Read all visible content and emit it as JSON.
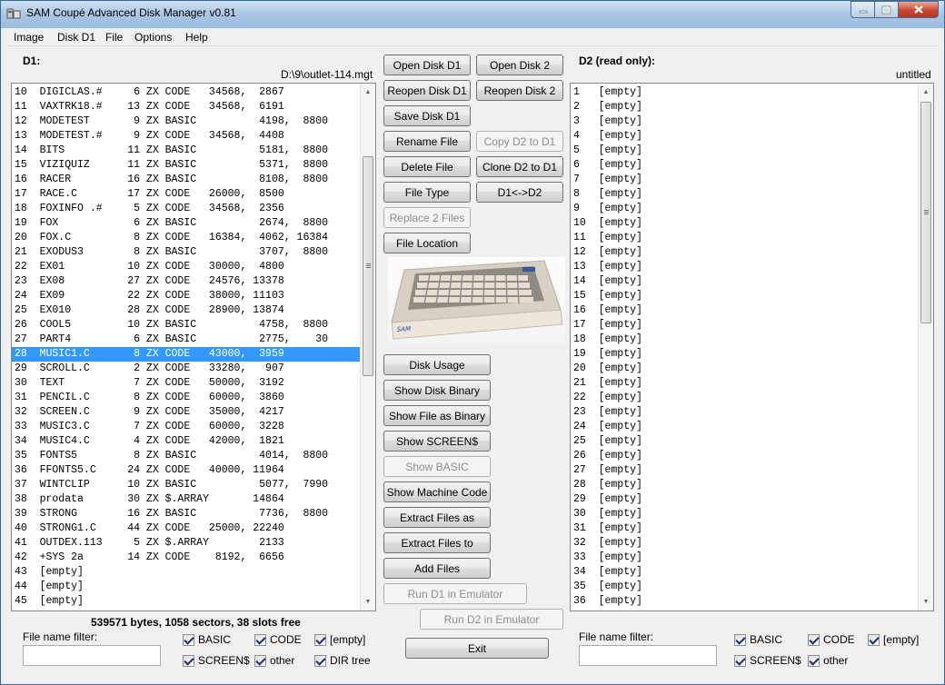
{
  "window": {
    "title": "SAM Coupé Advanced Disk Manager v0.81"
  },
  "menu": [
    "Image",
    "Disk D1",
    "File",
    "Options",
    "Help"
  ],
  "d1": {
    "label": "D1:",
    "path": "D:\\9\\outlet-114.mgt",
    "status": "539571 bytes, 1058 sectors, 38 slots free",
    "selected_index": 18,
    "rows": [
      "10  DIGICLAS.#     6 ZX CODE   34568,  2867",
      "11  VAXTRK18.#    13 ZX CODE   34568,  6191",
      "12  MODETEST       9 ZX BASIC          4198,  8800",
      "13  MODETEST.#     9 ZX CODE   34568,  4408",
      "14  BITS          11 ZX BASIC          5181,  8800",
      "15  VIZIQUIZ      11 ZX BASIC          5371,  8800",
      "16  RACER         16 ZX BASIC          8108,  8800",
      "17  RACE.C        17 ZX CODE   26000,  8500",
      "18  FOXINFO .#     5 ZX CODE   34568,  2356",
      "19  FOX            6 ZX BASIC          2674,  8800",
      "20  FOX.C          8 ZX CODE   16384,  4062, 16384",
      "21  EXODUS3        8 ZX BASIC          3707,  8800",
      "22  EX01          10 ZX CODE   30000,  4800",
      "23  EX08          27 ZX CODE   24576, 13378",
      "24  EX09          22 ZX CODE   38000, 11103",
      "25  EX010         28 ZX CODE   28900, 13874",
      "26  COOL5         10 ZX BASIC          4758,  8800",
      "27  PART4          6 ZX BASIC          2775,    30",
      "28  MUSIC1.C       8 ZX CODE   43000,  3959",
      "29  SCROLL.C       2 ZX CODE   33280,   907",
      "30  TEXT           7 ZX CODE   50000,  3192",
      "31  PENCIL.C       8 ZX CODE   60000,  3860",
      "32  SCREEN.C       9 ZX CODE   35000,  4217",
      "33  MUSIC3.C       7 ZX CODE   60000,  3228",
      "34  MUSIC4.C       4 ZX CODE   42000,  1821",
      "35  FONTS5         8 ZX BASIC          4014,  8800",
      "36  FFONTS5.C     24 ZX CODE   40000, 11964",
      "37  WINTCLIP      10 ZX BASIC          5077,  7990",
      "38  prodata       30 ZX $.ARRAY       14864",
      "39  STRONG        16 ZX BASIC          7736,  8800",
      "40  STRONG1.C     44 ZX CODE   25000, 22240",
      "41  OUTDEX.113     5 ZX $.ARRAY        2133",
      "42  +SYS 2a       14 ZX CODE    8192,  6656",
      "43  [empty]",
      "44  [empty]",
      "45  [empty]"
    ],
    "filter_label": "File name filter:",
    "filter_value": "",
    "checks": [
      "BASIC",
      "CODE",
      "[empty]",
      "SCREEN$",
      "other",
      "DIR tree"
    ]
  },
  "d2": {
    "label": "D2 (read only):",
    "path": "untitled",
    "rows": [
      "1   [empty]",
      "2   [empty]",
      "3   [empty]",
      "4   [empty]",
      "5   [empty]",
      "6   [empty]",
      "7   [empty]",
      "8   [empty]",
      "9   [empty]",
      "10  [empty]",
      "11  [empty]",
      "12  [empty]",
      "13  [empty]",
      "14  [empty]",
      "15  [empty]",
      "16  [empty]",
      "17  [empty]",
      "18  [empty]",
      "19  [empty]",
      "20  [empty]",
      "21  [empty]",
      "22  [empty]",
      "23  [empty]",
      "24  [empty]",
      "25  [empty]",
      "26  [empty]",
      "27  [empty]",
      "28  [empty]",
      "29  [empty]",
      "30  [empty]",
      "31  [empty]",
      "32  [empty]",
      "33  [empty]",
      "34  [empty]",
      "35  [empty]",
      "36  [empty]"
    ],
    "filter_label": "File name filter:",
    "filter_value": "",
    "checks": [
      "BASIC",
      "CODE",
      "[empty]",
      "SCREEN$",
      "other"
    ]
  },
  "buttons": {
    "open_d1": "Open Disk D1",
    "open_d2": "Open Disk 2",
    "reopen_d1": "Reopen Disk D1",
    "reopen_d2": "Reopen Disk 2",
    "save_d1": "Save Disk D1",
    "rename": "Rename File",
    "copy_d2_d1": "Copy D2 to D1",
    "delete": "Delete File",
    "clone_d2_d1": "Clone D2 to D1",
    "file_type": "File Type",
    "swap": "D1<->D2",
    "replace2": "Replace 2 Files",
    "file_location": "File Location",
    "disk_usage": "Disk Usage",
    "show_disk_binary": "Show Disk Binary",
    "show_file_binary": "Show File as Binary",
    "show_screen": "Show SCREEN$",
    "show_basic": "Show BASIC",
    "show_machine_code": "Show Machine Code",
    "extract_as": "Extract Files as",
    "extract_to": "Extract Files to",
    "add_files": "Add Files",
    "run_d1": "Run D1 in Emulator",
    "run_d2": "Run D2 in Emulator",
    "exit": "Exit"
  },
  "images": {
    "keyboard": "SAM Coupé computer image"
  },
  "colors": {
    "selection": "#3399ff",
    "titlebar": "#a9c6e4"
  }
}
